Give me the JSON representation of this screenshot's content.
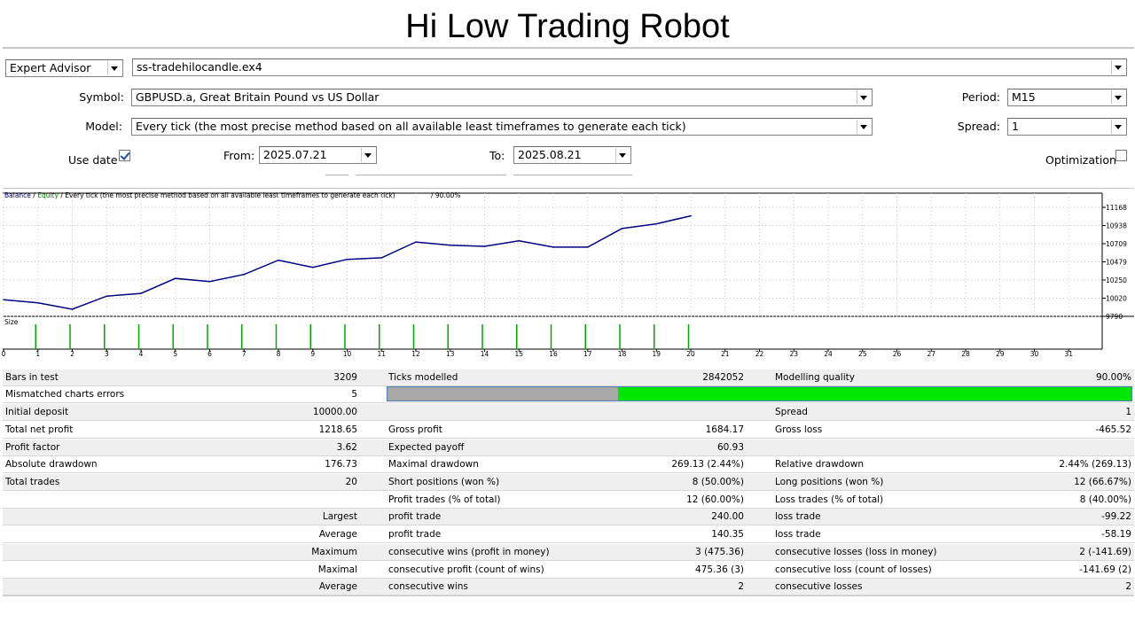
{
  "title": "Hi Low Trading Robot",
  "settings": {
    "mode": "Expert Advisor",
    "expert_file": "ss-tradehilocandle.ex4",
    "symbol_label": "Symbol:",
    "symbol": "GBPUSD.a, Great Britain Pound vs US Dollar",
    "period_label": "Period:",
    "period": "M15",
    "model_label": "Model:",
    "model": "Every tick (the most precise method based on all available least timeframes to generate each tick)",
    "spread_label": "Spread:",
    "spread": "1",
    "use_date_label": "Use date",
    "use_date_checked": true,
    "from_label": "From:",
    "from": "2025.07.21",
    "to_label": "To:",
    "to": "2025.08.21",
    "optimization_label": "Optimization"
  },
  "chart_data": {
    "type": "line",
    "header": {
      "balance": "Balance",
      "sep1": " / ",
      "equity": "Equity",
      "sep2": " / Every tick (the most precise method based on all available least timeframes to generate each tick)",
      "quality": "/ 90.00%"
    },
    "size_label": "Size",
    "x_ticks": [
      "0",
      "1",
      "2",
      "3",
      "4",
      "5",
      "6",
      "7",
      "8",
      "9",
      "10",
      "11",
      "12",
      "13",
      "14",
      "15",
      "16",
      "17",
      "18",
      "19",
      "20",
      "21",
      "22",
      "23",
      "24",
      "25",
      "26",
      "27",
      "28",
      "29",
      "30",
      "31"
    ],
    "y_ticks": [
      "11168",
      "10938",
      "10709",
      "10479",
      "10250",
      "10020",
      "9790"
    ],
    "ylim": [
      9790,
      11168
    ],
    "xlim": [
      0,
      31
    ],
    "series": [
      {
        "color": "#000080",
        "x": [
          0,
          1,
          2,
          3,
          4,
          5,
          6,
          7,
          8,
          9,
          10,
          11,
          12,
          13,
          14,
          15,
          16,
          17,
          18,
          19,
          20
        ],
        "values": [
          10000,
          9960,
          9880,
          10045,
          10080,
          10270,
          10230,
          10320,
          10500,
          10410,
          10510,
          10530,
          10730,
          10690,
          10675,
          10745,
          10665,
          10665,
          10900,
          10960,
          11060
        ]
      }
    ],
    "size_bars": [
      1,
      2,
      3,
      4,
      5,
      6,
      7,
      8,
      9,
      10,
      11,
      12,
      13,
      14,
      15,
      16,
      17,
      18,
      19,
      20
    ],
    "bar_color": "#00aa00",
    "colors": {
      "balance": "#000080",
      "equity": "#008000",
      "axis": "#000000",
      "grid": "#c8c8c8"
    }
  },
  "report": {
    "bars_in_test_label": "Bars in test",
    "bars_in_test": "3209",
    "ticks_modelled_label": "Ticks modelled",
    "ticks_modelled": "2842052",
    "modelling_quality_label": "Modelling quality",
    "modelling_quality": "90.00%",
    "mismatched_label": "Mismatched charts errors",
    "mismatched": "5",
    "quality_bar": {
      "grey_fraction": 0.31,
      "grey_color": "#a8a8a8",
      "green_color": "#00e600"
    },
    "initial_deposit_label": "Initial deposit",
    "initial_deposit": "10000.00",
    "spread_label": "Spread",
    "spread": "1",
    "total_net_profit_label": "Total net profit",
    "total_net_profit": "1218.65",
    "gross_profit_label": "Gross profit",
    "gross_profit": "1684.17",
    "gross_loss_label": "Gross loss",
    "gross_loss": "-465.52",
    "profit_factor_label": "Profit factor",
    "profit_factor": "3.62",
    "expected_payoff_label": "Expected payoff",
    "expected_payoff": "60.93",
    "absolute_drawdown_label": "Absolute drawdown",
    "absolute_drawdown": "176.73",
    "maximal_drawdown_label": "Maximal drawdown",
    "maximal_drawdown": "269.13 (2.44%)",
    "relative_drawdown_label": "Relative drawdown",
    "relative_drawdown": "2.44% (269.13)",
    "total_trades_label": "Total trades",
    "total_trades": "20",
    "short_positions_label": "Short positions (won %)",
    "short_positions": "8 (50.00%)",
    "long_positions_label": "Long positions (won %)",
    "long_positions": "12 (66.67%)",
    "profit_trades_label": "Profit trades (% of total)",
    "profit_trades": "12 (60.00%)",
    "loss_trades_label": "Loss trades (% of total)",
    "loss_trades": "8 (40.00%)",
    "largest_label": "Largest",
    "largest_profit_label": "profit trade",
    "largest_profit": "240.00",
    "largest_loss_label": "loss trade",
    "largest_loss": "-99.22",
    "average_label": "Average",
    "average_profit_label": "profit trade",
    "average_profit": "140.35",
    "average_loss_label": "loss trade",
    "average_loss": "-58.19",
    "maximum_label": "Maximum",
    "max_consec_wins_label": "consecutive wins (profit in money)",
    "max_consec_wins": "3 (475.36)",
    "max_consec_losses_label": "consecutive losses (loss in money)",
    "max_consec_losses": "2 (-141.69)",
    "maximal_label": "Maximal",
    "maximal_consec_profit_label": "consecutive profit (count of wins)",
    "maximal_consec_profit": "475.36 (3)",
    "maximal_consec_loss_label": "consecutive loss (count of losses)",
    "maximal_consec_loss": "-141.69 (2)",
    "average2_label": "Average",
    "avg_consec_wins_label": "consecutive wins",
    "avg_consec_wins": "2",
    "avg_consec_losses_label": "consecutive losses",
    "avg_consec_losses": "2"
  }
}
